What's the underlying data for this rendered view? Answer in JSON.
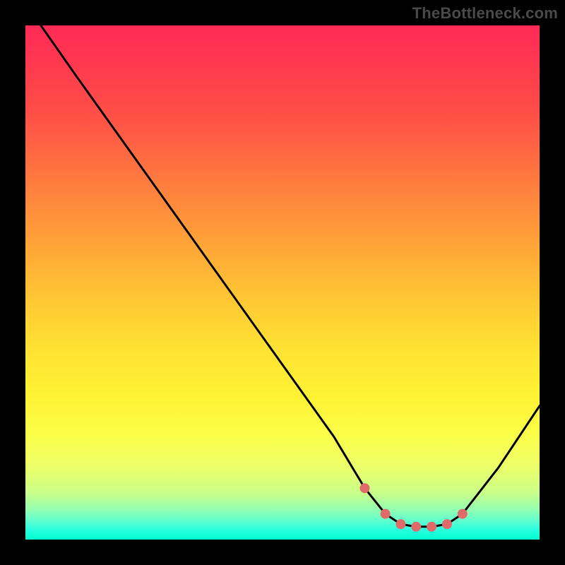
{
  "watermark": "TheBottleneck.com",
  "chart_data": {
    "type": "line",
    "title": "",
    "xlabel": "",
    "ylabel": "",
    "xlim": [
      0,
      100
    ],
    "ylim": [
      0,
      100
    ],
    "grid": false,
    "legend": false,
    "series": [
      {
        "name": "bottleneck-curve",
        "color": "#000000",
        "stroke_width": 3,
        "x": [
          3,
          10,
          20,
          30,
          40,
          50,
          60,
          66,
          70,
          73,
          76,
          79,
          82,
          85,
          92,
          100
        ],
        "values": [
          100,
          90,
          76,
          62,
          48,
          34,
          20,
          10,
          5,
          3,
          2.5,
          2.5,
          3,
          5,
          14,
          26
        ]
      }
    ],
    "markers": {
      "name": "highlight-dots",
      "color": "#e06a6a",
      "radius": 7,
      "x": [
        66,
        70,
        73,
        76,
        79,
        82,
        85
      ],
      "values": [
        10,
        5,
        3,
        2.5,
        2.5,
        3,
        5
      ]
    }
  }
}
